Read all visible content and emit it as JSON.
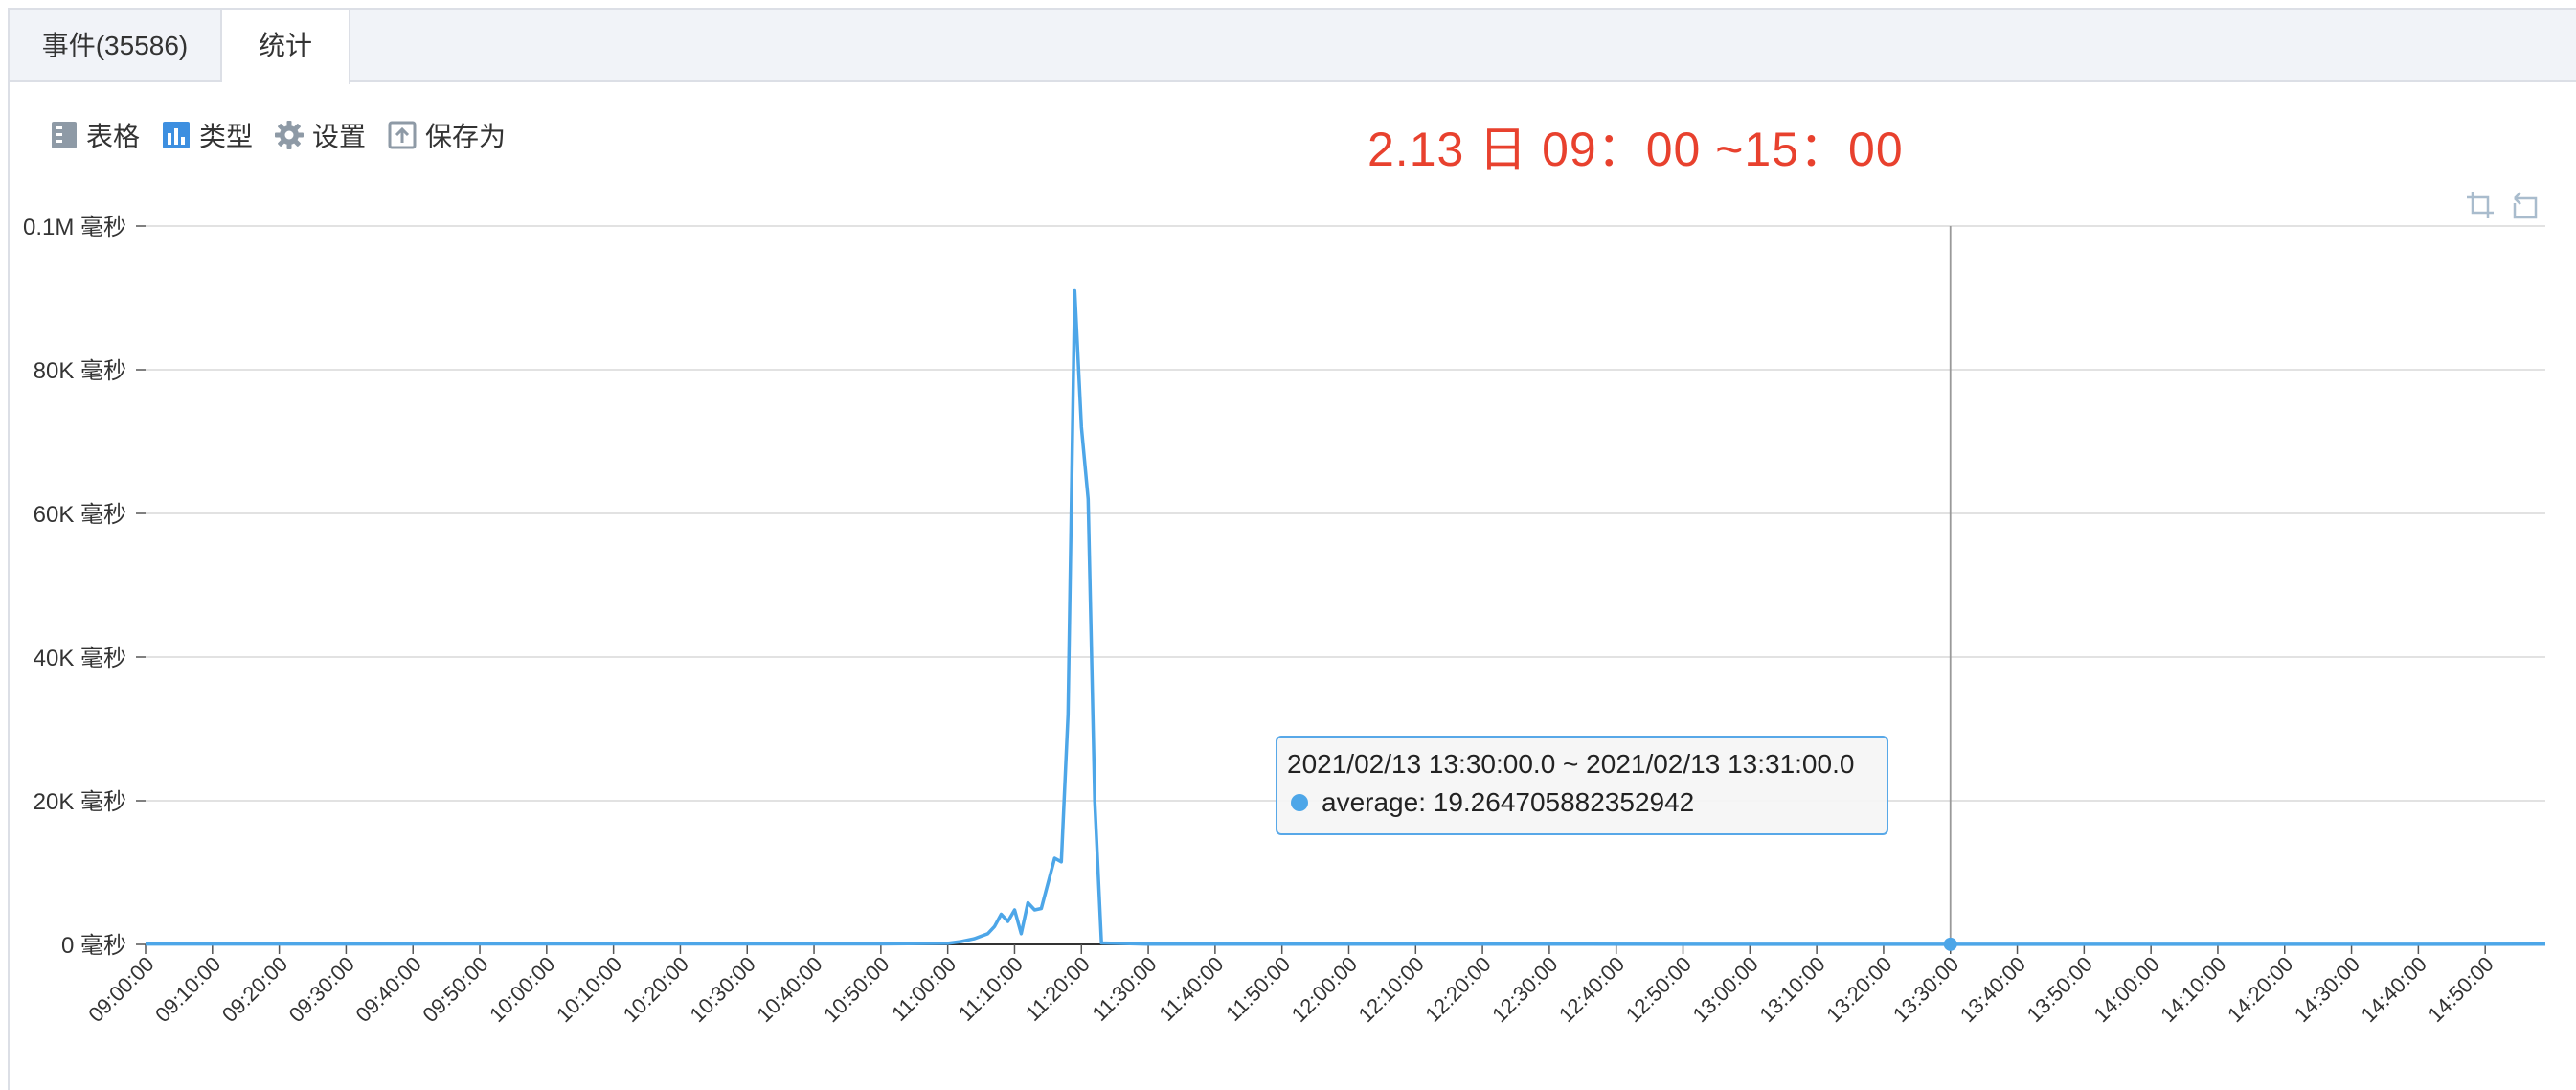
{
  "tabs": [
    {
      "label": "事件(35586)"
    },
    {
      "label": "统计"
    }
  ],
  "toolbar": {
    "table": "表格",
    "type": "类型",
    "settings": "设置",
    "save_as": "保存为"
  },
  "headline": "2.13 日  09：00 ~15：00",
  "colors": {
    "line": "#4da6e8",
    "headline": "#e8412e",
    "grid": "#d8d8d8"
  },
  "tooltip": {
    "title": "2021/02/13 13:30:00.0 ~ 2021/02/13 13:31:00.0",
    "series": "average",
    "value": "19.264705882352942"
  },
  "chart_data": {
    "type": "line",
    "title": "",
    "xlabel": "",
    "ylabel": "",
    "ylim": [
      0,
      100000
    ],
    "xlim": [
      "09:00:00",
      "14:59:00"
    ],
    "y_ticks": [
      {
        "value": 0,
        "label": "0 毫秒"
      },
      {
        "value": 20000,
        "label": "20K 毫秒"
      },
      {
        "value": 40000,
        "label": "40K 毫秒"
      },
      {
        "value": 60000,
        "label": "60K 毫秒"
      },
      {
        "value": 80000,
        "label": "80K 毫秒"
      },
      {
        "value": 100000,
        "label": "0.1M 毫秒"
      }
    ],
    "x_ticks": [
      "09:00:00",
      "09:10:00",
      "09:20:00",
      "09:30:00",
      "09:40:00",
      "09:50:00",
      "10:00:00",
      "10:10:00",
      "10:20:00",
      "10:30:00",
      "10:40:00",
      "10:50:00",
      "11:00:00",
      "11:10:00",
      "11:20:00",
      "11:30:00",
      "11:40:00",
      "11:50:00",
      "12:00:00",
      "12:10:00",
      "12:20:00",
      "12:30:00",
      "12:40:00",
      "12:50:00",
      "13:00:00",
      "13:10:00",
      "13:20:00",
      "13:30:00",
      "13:40:00",
      "13:50:00",
      "14:00:00",
      "14:10:00",
      "14:20:00",
      "14:30:00",
      "14:40:00",
      "14:50:00"
    ],
    "grid": true,
    "crosshair_x": "13:30:00",
    "series": [
      {
        "name": "average",
        "points": [
          [
            "09:00:00",
            50
          ],
          [
            "10:50:00",
            60
          ],
          [
            "11:00:00",
            150
          ],
          [
            "11:02:00",
            400
          ],
          [
            "11:04:00",
            800
          ],
          [
            "11:06:00",
            1500
          ],
          [
            "11:07:00",
            2500
          ],
          [
            "11:08:00",
            4200
          ],
          [
            "11:09:00",
            3200
          ],
          [
            "11:10:00",
            4800
          ],
          [
            "11:11:00",
            1500
          ],
          [
            "11:12:00",
            5800
          ],
          [
            "11:13:00",
            4800
          ],
          [
            "11:14:00",
            5000
          ],
          [
            "11:16:00",
            12000
          ],
          [
            "11:17:00",
            11500
          ],
          [
            "11:18:00",
            32000
          ],
          [
            "11:19:00",
            91000
          ],
          [
            "11:20:00",
            72000
          ],
          [
            "11:21:00",
            62000
          ],
          [
            "11:22:00",
            20000
          ],
          [
            "11:23:00",
            200
          ],
          [
            "11:30:00",
            40
          ],
          [
            "13:30:00",
            19.26
          ],
          [
            "14:59:00",
            30
          ]
        ]
      }
    ]
  }
}
